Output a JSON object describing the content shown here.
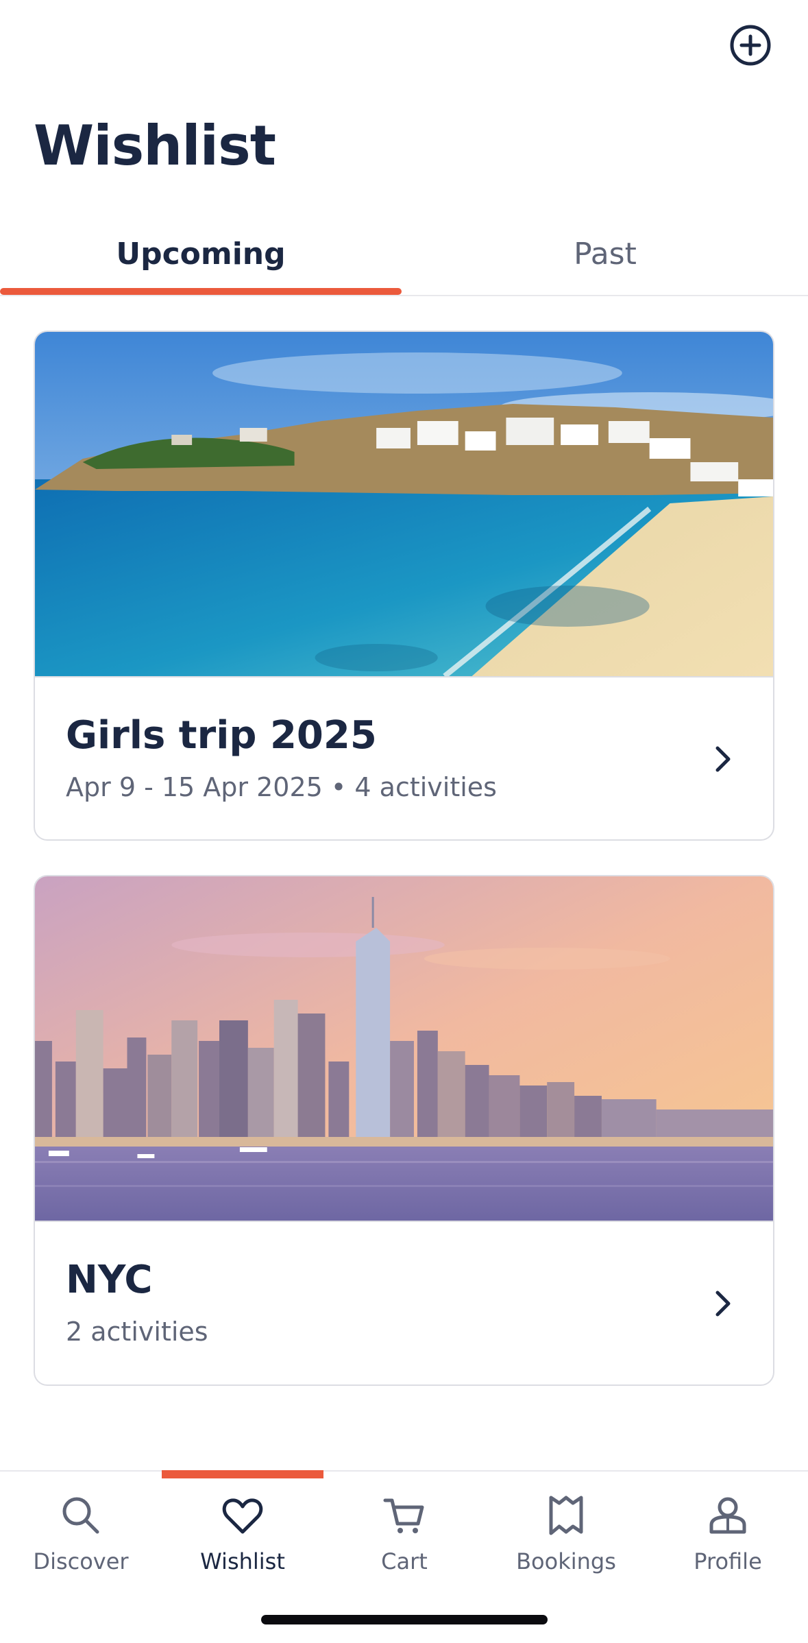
{
  "header": {
    "title": "Wishlist",
    "add_icon": "plus-circle-icon"
  },
  "tabs": [
    {
      "label": "Upcoming",
      "active": true
    },
    {
      "label": "Past",
      "active": false
    }
  ],
  "colors": {
    "accent": "#eb5a3c",
    "text_primary": "#1b2742",
    "text_secondary": "#5f6577",
    "border": "#dcdde3"
  },
  "wishlists": [
    {
      "title": "Girls trip 2025",
      "subtitle": "Apr 9 - 15 Apr 2025 • 4 activities",
      "image": "beach-coastline-photo"
    },
    {
      "title": "NYC",
      "subtitle": "2 activities",
      "image": "city-skyline-photo"
    }
  ],
  "bottom_nav": {
    "items": [
      {
        "label": "Discover",
        "icon": "search-icon",
        "active": false
      },
      {
        "label": "Wishlist",
        "icon": "heart-icon",
        "active": true
      },
      {
        "label": "Cart",
        "icon": "cart-icon",
        "active": false
      },
      {
        "label": "Bookings",
        "icon": "bookmark-map-icon",
        "active": false
      },
      {
        "label": "Profile",
        "icon": "profile-icon",
        "active": false
      }
    ]
  }
}
